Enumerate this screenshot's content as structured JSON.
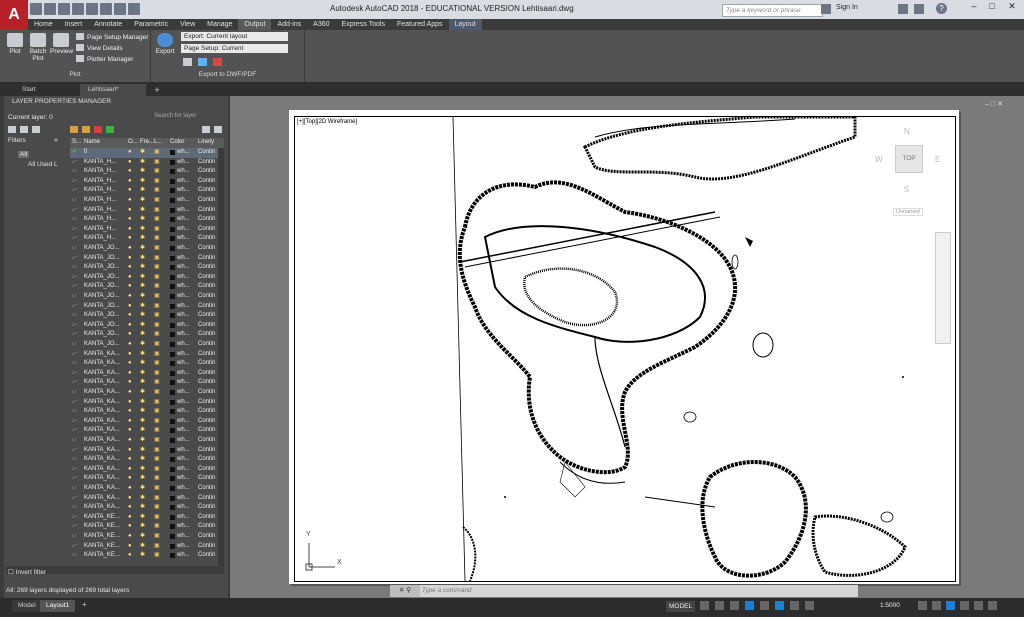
{
  "app": {
    "title": "Autodesk AutoCAD 2018 - EDUCATIONAL VERSION   Lehtisaari.dwg",
    "logo_letter": "A",
    "search_placeholder": "Type a keyword or phrase",
    "sign_in": "Sign In",
    "help": "?"
  },
  "ribbon": {
    "tabs": [
      "Home",
      "Insert",
      "Annotate",
      "Parametric",
      "View",
      "Manage",
      "Output",
      "Add-ins",
      "A360",
      "Express Tools",
      "Featured Apps",
      "Layout"
    ],
    "active_tab": "Output",
    "plot_panel": {
      "plot": "Plot",
      "batch_plot": "Batch Plot",
      "preview": "Preview",
      "page_setup_manager": "Page Setup Manager",
      "view_details": "View Details",
      "plotter_manager": "Plotter Manager",
      "title": "Plot"
    },
    "export_panel": {
      "export": "Export",
      "export_combo": "Export: Current layout",
      "page_setup_combo": "Page Setup: Current",
      "title": "Export to DWF/PDF"
    }
  },
  "file_tabs": [
    "Start",
    "Lehtisaari*"
  ],
  "layer_manager": {
    "title": "LAYER PROPERTIES MANAGER",
    "current_layer": "Current layer: 0",
    "search_placeholder": "Search for layer",
    "filters_label": "Filters",
    "filter_all": "All",
    "filter_used": "All Used L",
    "invert_filter": "Invert filter",
    "status": "All: 269 layers displayed of 269 total layers",
    "columns": [
      "S...",
      "Name",
      "O...",
      "Fre...",
      "L...",
      "Color",
      "Linety"
    ],
    "rows": [
      {
        "name": "0",
        "color": "wh...",
        "ltype": "Contin"
      },
      {
        "name": "KANTA_H...",
        "color": "wh...",
        "ltype": "Contin"
      },
      {
        "name": "KANTA_H...",
        "color": "wh...",
        "ltype": "Contin"
      },
      {
        "name": "KANTA_H...",
        "color": "wh...",
        "ltype": "Contin"
      },
      {
        "name": "KANTA_H...",
        "color": "wh...",
        "ltype": "Contin"
      },
      {
        "name": "KANTA_H...",
        "color": "wh...",
        "ltype": "Contin"
      },
      {
        "name": "KANTA_H...",
        "color": "wh...",
        "ltype": "Contin"
      },
      {
        "name": "KANTA_H...",
        "color": "wh...",
        "ltype": "Contin"
      },
      {
        "name": "KANTA_H...",
        "color": "wh...",
        "ltype": "Contin"
      },
      {
        "name": "KANTA_H...",
        "color": "wh...",
        "ltype": "Contin"
      },
      {
        "name": "KANTA_JO...",
        "color": "wh...",
        "ltype": "Contin"
      },
      {
        "name": "KANTA_JO...",
        "color": "wh...",
        "ltype": "Contin"
      },
      {
        "name": "KANTA_JO...",
        "color": "wh...",
        "ltype": "Contin"
      },
      {
        "name": "KANTA_JO...",
        "color": "wh...",
        "ltype": "Contin"
      },
      {
        "name": "KANTA_JO...",
        "color": "wh...",
        "ltype": "Contin"
      },
      {
        "name": "KANTA_JO...",
        "color": "wh...",
        "ltype": "Contin"
      },
      {
        "name": "KANTA_JO...",
        "color": "wh...",
        "ltype": "Contin"
      },
      {
        "name": "KANTA_JO...",
        "color": "wh...",
        "ltype": "Contin"
      },
      {
        "name": "KANTA_JO...",
        "color": "wh...",
        "ltype": "Contin"
      },
      {
        "name": "KANTA_JO...",
        "color": "wh...",
        "ltype": "Contin"
      },
      {
        "name": "KANTA_JO...",
        "color": "wh...",
        "ltype": "Contin"
      },
      {
        "name": "KANTA_KA...",
        "color": "wh...",
        "ltype": "Contin"
      },
      {
        "name": "KANTA_KA...",
        "color": "wh...",
        "ltype": "Contin"
      },
      {
        "name": "KANTA_KA...",
        "color": "wh...",
        "ltype": "Contin"
      },
      {
        "name": "KANTA_KA...",
        "color": "wh...",
        "ltype": "Contin"
      },
      {
        "name": "KANTA_KA...",
        "color": "wh...",
        "ltype": "Contin"
      },
      {
        "name": "KANTA_KA...",
        "color": "wh...",
        "ltype": "Contin"
      },
      {
        "name": "KANTA_KA...",
        "color": "wh...",
        "ltype": "Contin"
      },
      {
        "name": "KANTA_KA...",
        "color": "wh...",
        "ltype": "Contin"
      },
      {
        "name": "KANTA_KA...",
        "color": "wh...",
        "ltype": "Contin"
      },
      {
        "name": "KANTA_KA...",
        "color": "wh...",
        "ltype": "Contin"
      },
      {
        "name": "KANTA_KA...",
        "color": "wh...",
        "ltype": "Contin"
      },
      {
        "name": "KANTA_KA...",
        "color": "wh...",
        "ltype": "Contin"
      },
      {
        "name": "KANTA_KA...",
        "color": "wh...",
        "ltype": "Contin"
      },
      {
        "name": "KANTA_KA...",
        "color": "wh...",
        "ltype": "Contin"
      },
      {
        "name": "KANTA_KA...",
        "color": "wh...",
        "ltype": "Contin"
      },
      {
        "name": "KANTA_KA...",
        "color": "wh...",
        "ltype": "Contin"
      },
      {
        "name": "KANTA_KA...",
        "color": "wh...",
        "ltype": "Contin"
      },
      {
        "name": "KANTA_KE...",
        "color": "wh...",
        "ltype": "Contin"
      },
      {
        "name": "KANTA_KE...",
        "color": "wh...",
        "ltype": "Contin"
      },
      {
        "name": "KANTA_KE...",
        "color": "wh...",
        "ltype": "Contin"
      },
      {
        "name": "KANTA_KE...",
        "color": "wh...",
        "ltype": "Contin"
      },
      {
        "name": "KANTA_KE...",
        "color": "wh...",
        "ltype": "Contin"
      }
    ]
  },
  "drawing": {
    "viewport_label": "[+][Top][2D Wireframe]",
    "viewcube": {
      "n": "N",
      "s": "S",
      "e": "E",
      "w": "W",
      "top": "TOP",
      "wcs": "Unnamed"
    },
    "ucs_x": "X",
    "ucs_y": "Y"
  },
  "command_line": {
    "placeholder": "Type a command"
  },
  "status_bar": {
    "model_tab": "Model",
    "layout_tab": "Layout1",
    "space": "MODEL",
    "scale": "1:5000"
  },
  "colors": {
    "accent": "#1b7fd6",
    "logo": "#b8202a"
  }
}
